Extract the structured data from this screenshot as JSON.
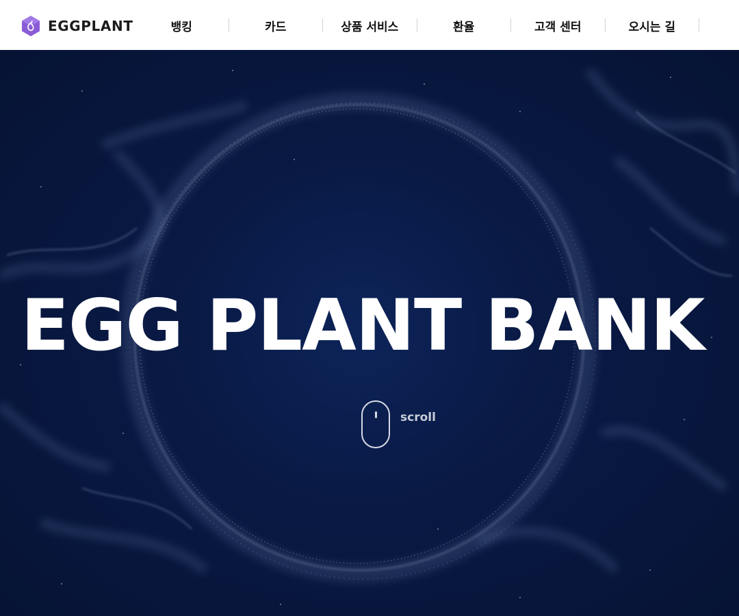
{
  "header": {
    "logo_text": "EGGPLANT",
    "nav": [
      {
        "label": "뱅킹"
      },
      {
        "label": "카드"
      },
      {
        "label": "상품 서비스"
      },
      {
        "label": "환율"
      },
      {
        "label": "고객 센터"
      },
      {
        "label": "오시는 길"
      }
    ]
  },
  "hero": {
    "title": "EGG PLANT BANK",
    "scroll_label": "scroll"
  },
  "colors": {
    "brand_purple": "#8a5cd6",
    "hero_background": "#08163d",
    "particle": "#c9d6f0"
  },
  "icons": [
    "eggplant-logo-icon",
    "mouse-scroll-icon"
  ]
}
